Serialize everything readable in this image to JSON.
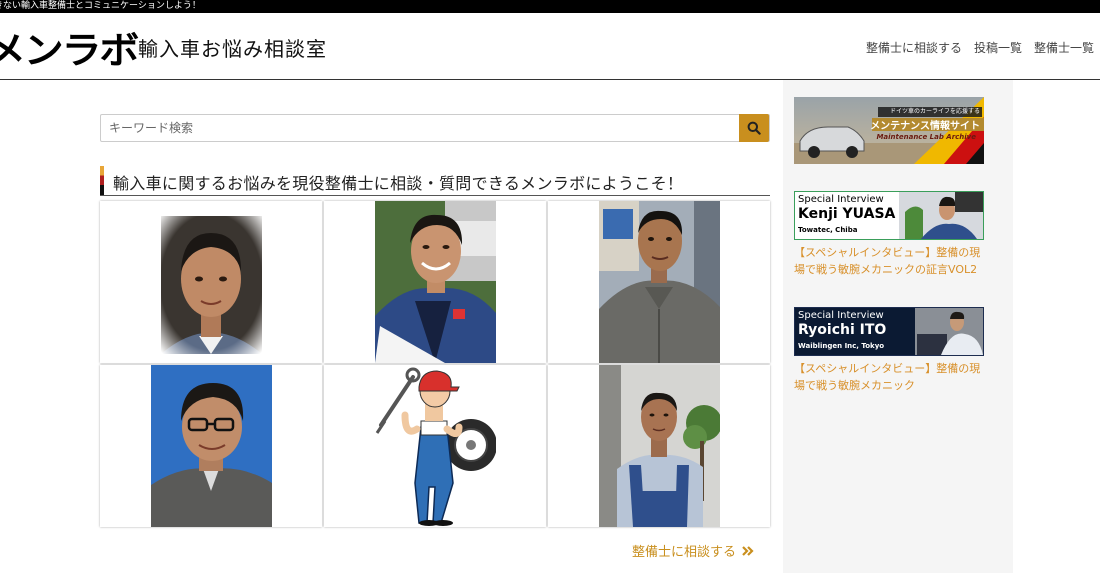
{
  "topbar": {
    "text": "きない輸入車整備士とコミュニケーションしよう！"
  },
  "header": {
    "logo_text": "メンラボ",
    "logo_subtitle": "輸入車お悩み相談室",
    "nav": [
      "整備士に相談する",
      "投稿一覧",
      "整備士一覧"
    ]
  },
  "search": {
    "placeholder": "キーワード検索"
  },
  "welcome": {
    "heading": "輸入車に関するお悩みを現役整備士に相談・質問できるメンラボにようこそ！"
  },
  "mechanics_grid": {
    "items": [
      {
        "icon": "mechanic-photo-1"
      },
      {
        "icon": "mechanic-photo-2"
      },
      {
        "icon": "mechanic-photo-3"
      },
      {
        "icon": "mechanic-photo-4"
      },
      {
        "icon": "mechanic-cartoon"
      },
      {
        "icon": "mechanic-photo-6"
      }
    ]
  },
  "cta": {
    "label": "整備士に相談する",
    "icon": "double-chevron-right-icon"
  },
  "sidebar": {
    "banner1": {
      "tagline": "ドイツ車のカーライフを応援する",
      "title": "メンテナンス情報サイト",
      "brand": "Maintenance Lab Archive"
    },
    "banner2": {
      "label": "Special Interview",
      "name": "Kenji YUASA",
      "company": "Towatec, Chiba",
      "link": "【スペシャルインタビュー】整備の現場で戦う敏腕メカニックの証言VOL2"
    },
    "banner3": {
      "label": "Special Interview",
      "name": "Ryoichi ITO",
      "company": "Waiblingen Inc, Tokyo",
      "link": "【スペシャルインタビュー】整備の現場で戦う敏腕メカニック"
    }
  },
  "colors": {
    "accent": "#c98f1e",
    "link": "#d8902a",
    "sidebar_bg": "#f5f5f5"
  }
}
